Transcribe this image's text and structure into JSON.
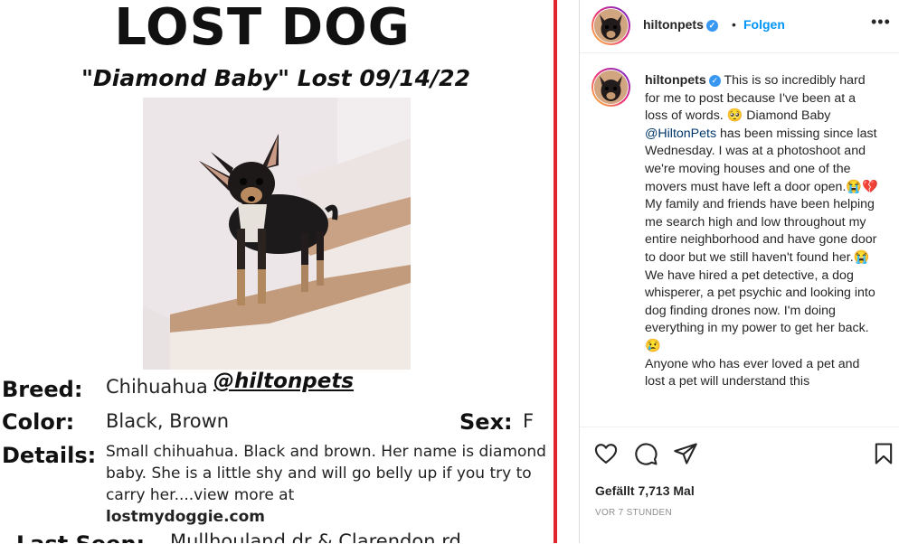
{
  "poster": {
    "title": "LOST DOG",
    "subtitle": "\"Diamond Baby\" Lost 09/14/22",
    "breed_label": "Breed:",
    "breed_value": "Chihuahua",
    "handle": "@hiltonpets",
    "color_label": "Color:",
    "color_value": "Black, Brown",
    "sex_label": "Sex:",
    "sex_value": "F",
    "details_label": "Details:",
    "details_text": "Small chihuahua. Black and brown. Her name is diamond baby. She is a little shy and will go belly up if you try to carry her....view more at",
    "details_link": "lostmydoggie.com",
    "last_seen_label": "Last Seen:",
    "last_seen_value": "Mullhouland dr & Clarendon rd"
  },
  "post": {
    "header": {
      "username": "hiltonpets",
      "separator": "•",
      "follow": "Folgen",
      "more_icon": "more-options-icon"
    },
    "caption": {
      "username": "hiltonpets",
      "part1": "This is so incredibly hard for me to post because I've been at a loss of words. 🥺 Diamond Baby",
      "mention": "@HiltonPets",
      "part2": "has been missing since last Wednesday. I was at a photoshoot and we're moving houses and one of the movers must have left a door open.😭💔 My family and friends have been helping me search high and low throughout my entire neighborhood and have gone door to door but we still haven't found her.😭 We have hired a pet detective, a dog whisperer, a pet psychic and looking into dog finding drones now. I'm doing everything in my power to get her back. 😢",
      "part3": "Anyone who has ever loved a pet and lost a pet will understand this"
    },
    "likes": "Gefällt 7,713 Mal",
    "timestamp": "VOR 7 STUNDEN"
  },
  "colors": {
    "accent_red": "#e0242c",
    "link_blue": "#0095f6",
    "verified_blue": "#3897f0",
    "text": "#262626",
    "muted": "#8e8e8e"
  }
}
